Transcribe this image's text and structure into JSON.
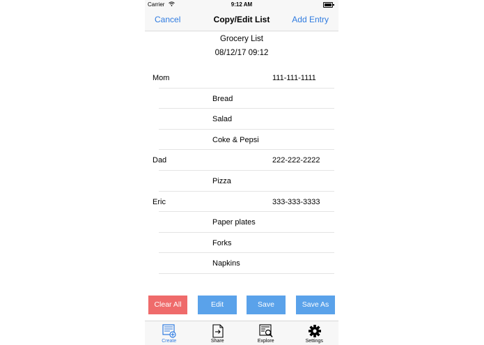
{
  "status": {
    "carrier": "Carrier",
    "time": "9:12 AM"
  },
  "nav": {
    "cancel": "Cancel",
    "title": "Copy/Edit List",
    "add_entry": "Add Entry"
  },
  "list": {
    "title": "Grocery List",
    "date": "08/12/17 09:12"
  },
  "rows": [
    {
      "type": "person",
      "name": "Mom",
      "phone": "111-111-1111"
    },
    {
      "type": "item",
      "name": "Bread"
    },
    {
      "type": "item",
      "name": "Salad"
    },
    {
      "type": "item",
      "name": "Coke & Pepsi"
    },
    {
      "type": "person",
      "name": "Dad",
      "phone": "222-222-2222"
    },
    {
      "type": "item",
      "name": "Pizza"
    },
    {
      "type": "person",
      "name": "Eric",
      "phone": "333-333-3333"
    },
    {
      "type": "item",
      "name": "Paper plates"
    },
    {
      "type": "item",
      "name": "Forks"
    },
    {
      "type": "item",
      "name": "Napkins"
    }
  ],
  "buttons": {
    "clear_all": "Clear All",
    "edit": "Edit",
    "save": "Save",
    "save_as": "Save As"
  },
  "tabs": [
    {
      "label": "Create",
      "icon": "create-icon",
      "active": true
    },
    {
      "label": "Share",
      "icon": "share-icon",
      "active": false
    },
    {
      "label": "Explore",
      "icon": "explore-icon",
      "active": false
    },
    {
      "label": "Settings",
      "icon": "gear-icon",
      "active": false
    }
  ],
  "colors": {
    "accent": "#2f7be0",
    "button_blue": "#5aa2ea",
    "button_red": "#ef6b6b"
  }
}
